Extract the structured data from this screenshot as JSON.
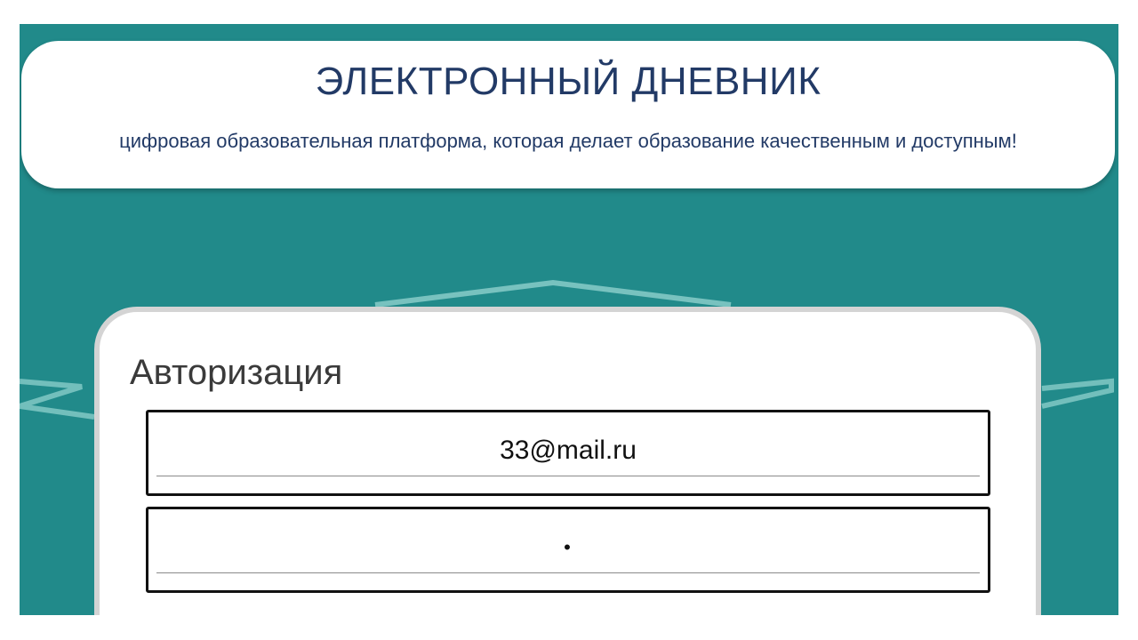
{
  "header": {
    "title": "ЭЛЕКТРОННЫЙ ДНЕВНИК",
    "subtitle": "цифровая образовательная платформа, которая делает образование качественным и доступным!"
  },
  "login": {
    "title": "Авторизация",
    "email_value": "33@mail.ru",
    "password_value": "•"
  },
  "colors": {
    "background": "#218a8a",
    "title_text": "#223a66",
    "card": "#ffffff",
    "card_border": "#d4d4d4"
  }
}
